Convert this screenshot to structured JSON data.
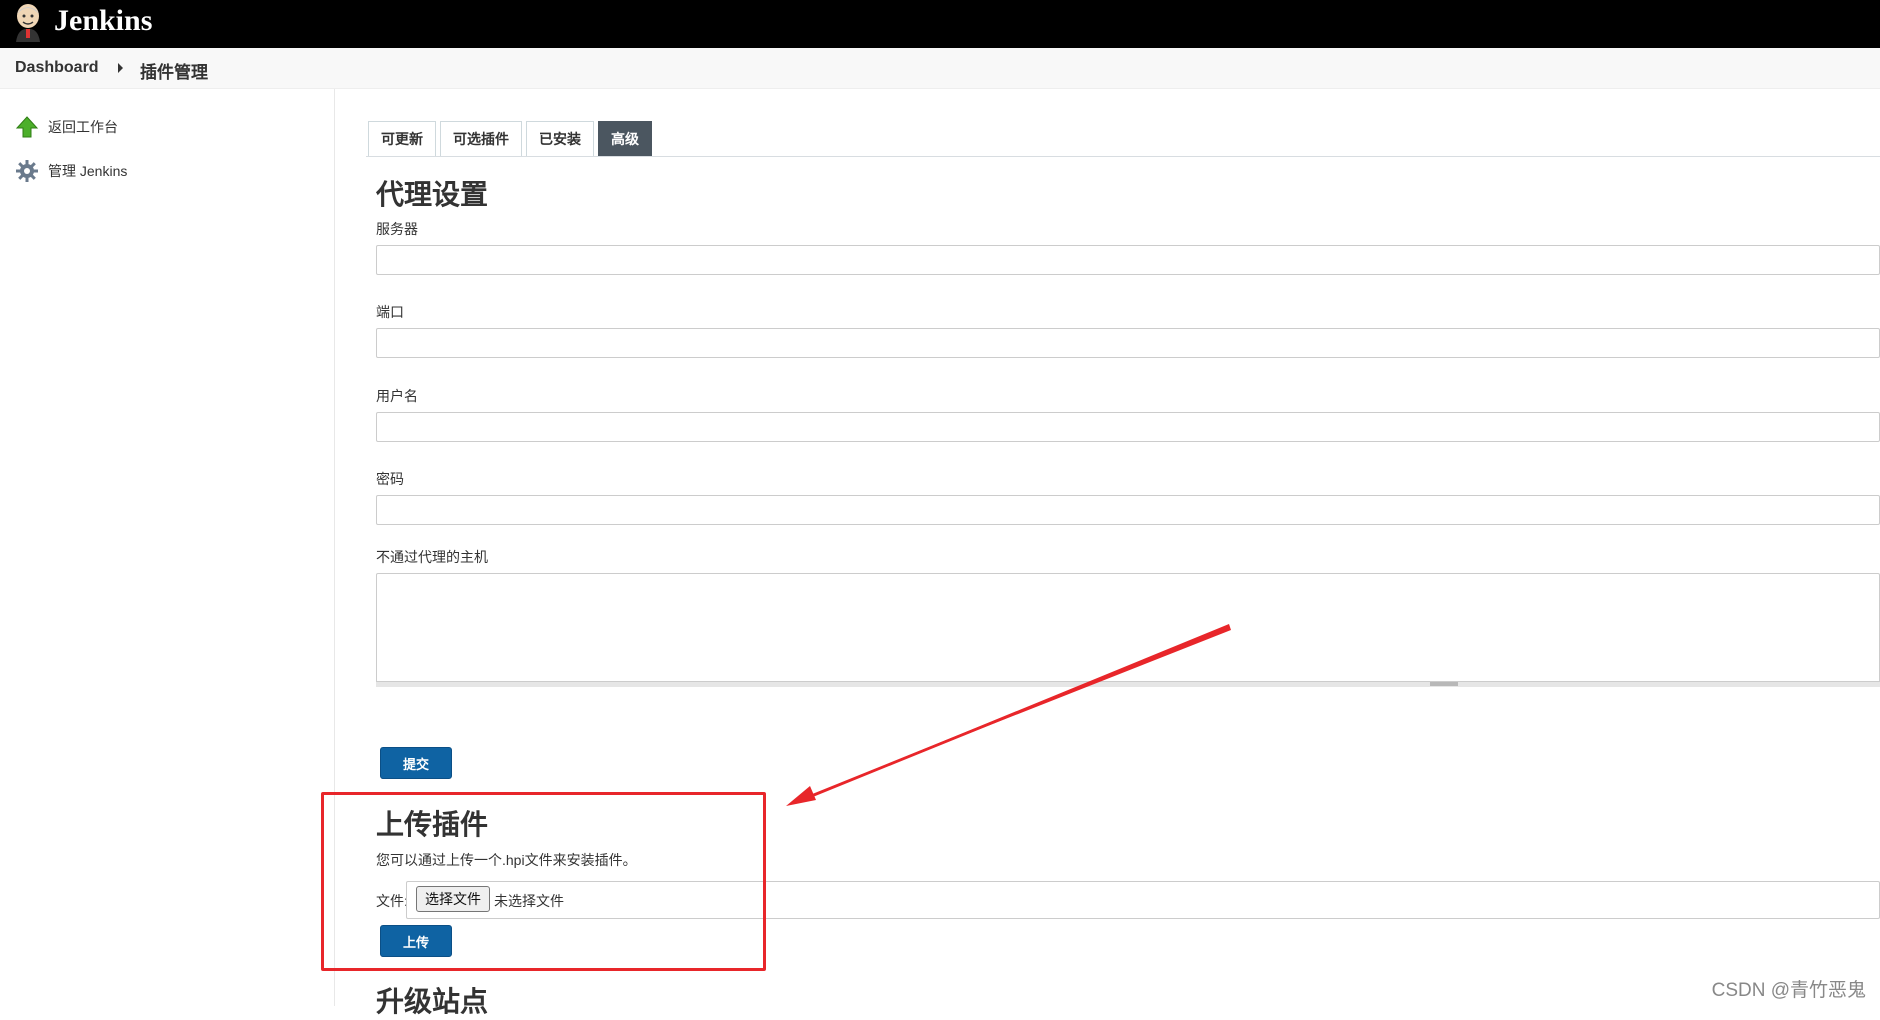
{
  "header": {
    "brand": "Jenkins"
  },
  "breadcrumb": {
    "root": "Dashboard",
    "current": "插件管理"
  },
  "sidebar": {
    "items": [
      {
        "label": "返回工作台",
        "icon": "up-arrow-icon"
      },
      {
        "label": "管理 Jenkins",
        "icon": "gear-icon"
      }
    ]
  },
  "tabs": [
    {
      "label": "可更新"
    },
    {
      "label": "可选插件"
    },
    {
      "label": "已安装"
    },
    {
      "label": "高级",
      "active": true
    }
  ],
  "proxy": {
    "title": "代理设置",
    "server_label": "服务器",
    "server_value": "",
    "port_label": "端口",
    "port_value": "",
    "username_label": "用户名",
    "username_value": "",
    "password_label": "密码",
    "password_value": "",
    "no_proxy_label": "不通过代理的主机",
    "no_proxy_value": "",
    "submit_label": "提交"
  },
  "upload": {
    "title": "上传插件",
    "description": "您可以通过上传一个.hpi文件来安装插件。",
    "file_label": "文件:",
    "choose_label": "选择文件",
    "no_file_text": "未选择文件",
    "upload_label": "上传"
  },
  "update_site": {
    "title": "升级站点"
  },
  "watermark": "CSDN @青竹恶鬼",
  "colors": {
    "accent": "#0f63a3",
    "annotation": "#e8262a",
    "tab_active": "#4b5660"
  }
}
